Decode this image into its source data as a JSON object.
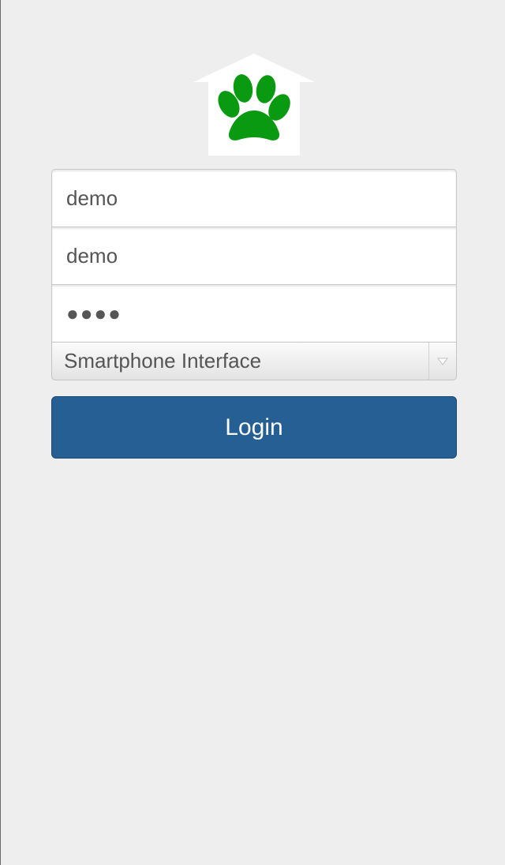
{
  "logo": {
    "icon": "paw-house-icon",
    "paw_color": "#0a9a12",
    "house_color": "#ffffff"
  },
  "form": {
    "field1": {
      "value": "demo"
    },
    "field2": {
      "value": "demo"
    },
    "password": {
      "masked_value": "●●●●"
    },
    "interface_select": {
      "selected": "Smartphone Interface",
      "arrow_icon": "triangle-down-icon"
    }
  },
  "login_button": {
    "label": "Login",
    "color": "#255f93"
  }
}
